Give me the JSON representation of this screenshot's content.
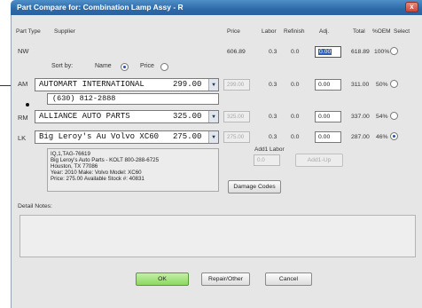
{
  "window": {
    "title": "Part Compare for: Combination Lamp Assy - R",
    "close_glyph": "x"
  },
  "headers": {
    "part_type": "Part Type",
    "supplier": "Supplier",
    "price": "Price",
    "labor": "Labor",
    "refinish": "Refinish",
    "adj": "Adj.",
    "total": "Total",
    "oem": "%OEM",
    "select": "Select"
  },
  "nw": {
    "type": "NW",
    "price": "606.89",
    "labor": "0.3",
    "refinish": "0.0",
    "adj": "0.00",
    "total": "618.89",
    "oem": "100%"
  },
  "sort": {
    "label": "Sort by:",
    "name": "Name",
    "price": "Price",
    "selected": "Name"
  },
  "rows": [
    {
      "type": "AM",
      "supplier": "AUTOMART INTERNATIONAL",
      "amount": "299.00",
      "price": "299.00",
      "labor": "0.3",
      "refinish": "0.0",
      "adj": "0.00",
      "total": "311.00",
      "oem": "50%",
      "phone": "(630) 812-2888"
    },
    {
      "type": "RM",
      "supplier": "ALLIANCE AUTO PARTS",
      "amount": "325.00",
      "price": "325.00",
      "labor": "0.3",
      "refinish": "0.0",
      "adj": "0.00",
      "total": "337.00",
      "oem": "54%"
    },
    {
      "type": "LK",
      "supplier": "Big Leroy's Au Volvo XC60",
      "amount": "275.00",
      "price": "275.00",
      "labor": "0.3",
      "refinish": "0.0",
      "adj": "0.00",
      "total": "287.00",
      "oem": "46%"
    }
  ],
  "selected_row": "LK",
  "info_lines": [
    "IQ,1,TAG-76619",
    "Big Leroy's Auto Parts - KOLT 800-288-6725",
    "Houston, TX  77086",
    "Year: 2010  Make: Volvo  Model: XC60",
    "Price: 275.00 Available Stock #: 40831"
  ],
  "add1_labor": {
    "label": "Add1 Labor",
    "value": "0.0"
  },
  "buttons": {
    "add1_up": "Add1-Up",
    "damage_codes": "Damage Codes",
    "ok": "OK",
    "repair_other": "Repair/Other",
    "cancel": "Cancel"
  },
  "detail_notes": {
    "label": "Detail Notes:"
  },
  "colors": {
    "titlebar": "#2d69a8",
    "ok_button": "#8bd860",
    "selection": "#2f5fb8"
  }
}
